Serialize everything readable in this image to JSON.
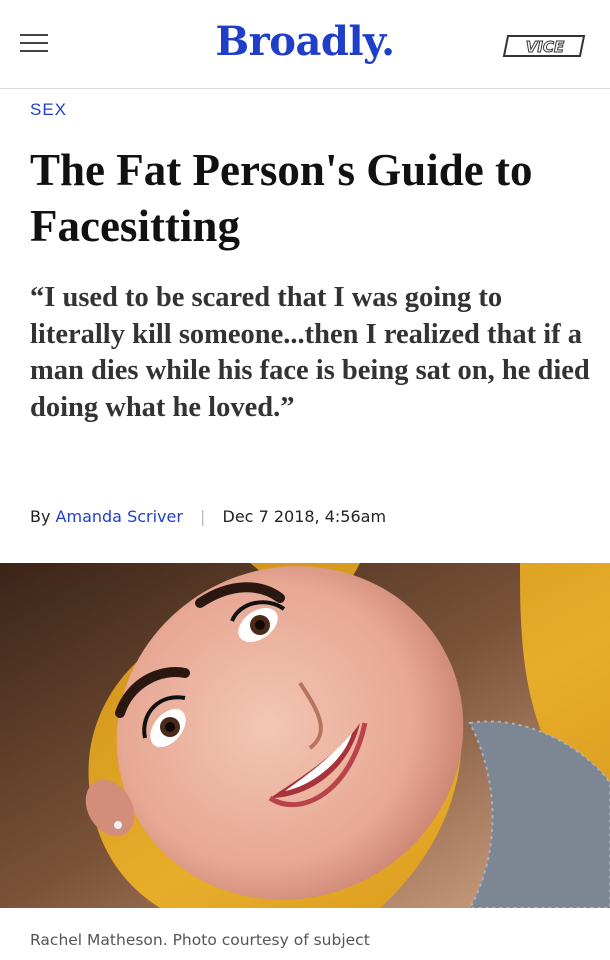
{
  "header": {
    "logo": "Broadly.",
    "brand_right": "VICE",
    "menu_icon": "hamburger-menu-icon"
  },
  "article": {
    "section": "SEX",
    "headline": "The Fat Person's Guide to Facesitting",
    "dek": "“I used to be scared that I was going to literally kill someone...then I realized that if a man dies while his face is being sat on, he died doing what he loved.”",
    "byline": {
      "prefix": "By",
      "author": "Amanda Scriver",
      "separator": "|",
      "date": "Dec 7 2018, 4:56am"
    },
    "image": {
      "caption": "Rachel Matheson. Photo courtesy of subject"
    }
  },
  "colors": {
    "brand_blue": "#1f3fc9",
    "photo_background": "#e1a521"
  }
}
